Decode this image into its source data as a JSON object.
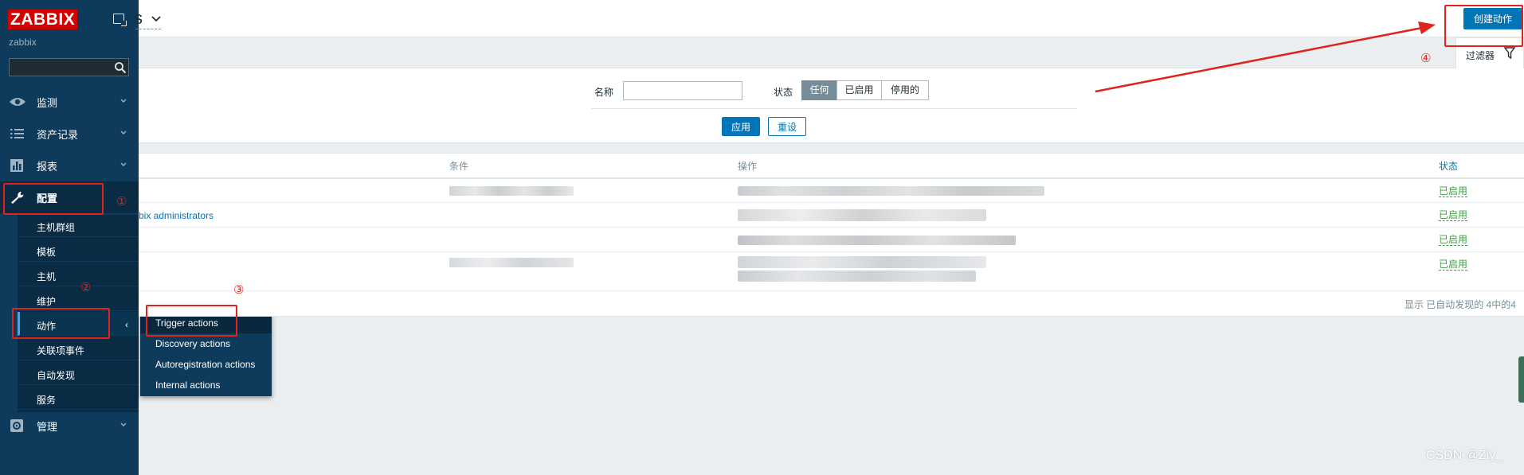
{
  "app": {
    "logo": "ZABBIX",
    "server_name": "zabbix",
    "accent": "#0275b8",
    "sidebar_bg": "#0e3a5b"
  },
  "sidebar": {
    "items": [
      {
        "label": "监测",
        "icon": "eye-icon"
      },
      {
        "label": "资产记录",
        "icon": "list-icon"
      },
      {
        "label": "报表",
        "icon": "bar-chart-icon"
      },
      {
        "label": "配置",
        "icon": "wrench-icon"
      },
      {
        "label": "管理",
        "icon": "gear-icon"
      }
    ],
    "config_submenu": [
      "主机群组",
      "模板",
      "主机",
      "维护",
      "动作",
      "关联项事件",
      "自动发现",
      "服务"
    ],
    "actions_flyout": [
      "Trigger actions",
      "Discovery actions",
      "Autoregistration actions",
      "Internal actions"
    ]
  },
  "header": {
    "title_fragment": "s",
    "create_button": "创建动作"
  },
  "filter": {
    "tab_label": "过滤器",
    "name_label": "名称",
    "name_value": "",
    "status_label": "状态",
    "status_options": [
      "任何",
      "已启用",
      "停用的"
    ],
    "status_selected": "任何",
    "apply": "应用",
    "reset": "重设"
  },
  "table": {
    "columns": [
      "条件",
      "操作",
      "状态"
    ],
    "rows": [
      {
        "name": "",
        "status": "已启用"
      },
      {
        "name": "bix administrators",
        "status": "已启用"
      },
      {
        "name": "",
        "status": "已启用"
      },
      {
        "name": "",
        "status": "已启用"
      }
    ],
    "footer": "显示 已自动发现的 4中的4"
  },
  "annotations": [
    "①",
    "②",
    "③",
    "④"
  ],
  "watermark": "CSDN @Ziy_"
}
